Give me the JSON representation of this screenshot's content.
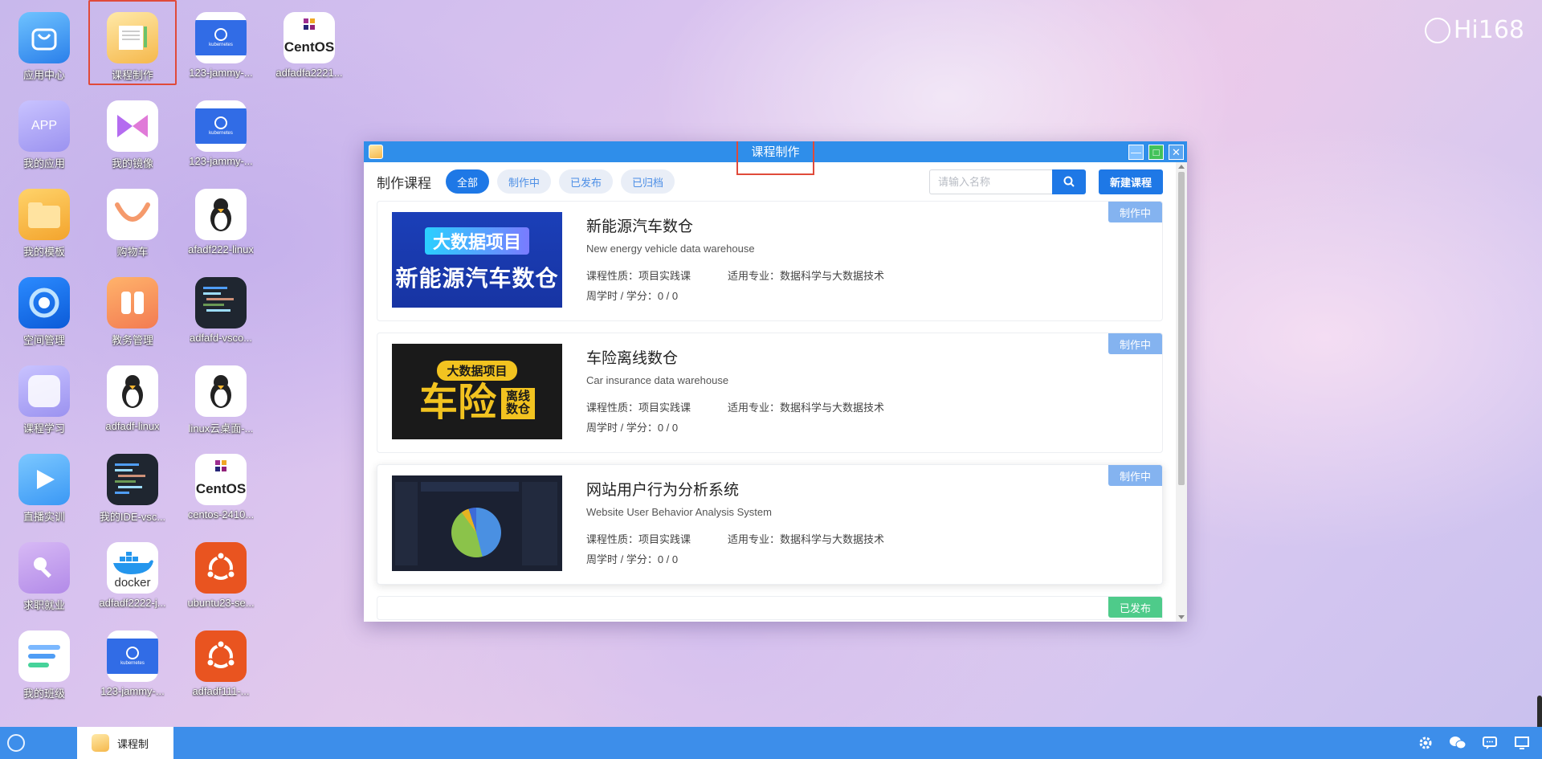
{
  "brand": {
    "text": "Hi168"
  },
  "desktop": {
    "icons": [
      {
        "label": "应用中心"
      },
      {
        "label": "课程制作"
      },
      {
        "label": "123-jammy-..."
      },
      {
        "label": "adfadfa2221..."
      },
      {
        "label": "我的应用",
        "tile_text": "APP"
      },
      {
        "label": "我的镜像"
      },
      {
        "label": "123-jammy-..."
      },
      {
        "label": "我的模板"
      },
      {
        "label": "购物车"
      },
      {
        "label": "afadf222-linux"
      },
      {
        "label": "空间管理"
      },
      {
        "label": "教务管理"
      },
      {
        "label": "adfafd-vsco..."
      },
      {
        "label": "课程学习"
      },
      {
        "label": "adfadf-linux"
      },
      {
        "label": "linux云桌面-..."
      },
      {
        "label": "直播实训"
      },
      {
        "label": "我的IDE-vsc..."
      },
      {
        "label": "centos-2410..."
      },
      {
        "label": "求职就业"
      },
      {
        "label": "adfadf2222-j..."
      },
      {
        "label": "ubuntu23-se..."
      },
      {
        "label": "我的班级"
      },
      {
        "label": "123-jammy-..."
      },
      {
        "label": "adfadf111-..."
      }
    ],
    "tile_texts": {
      "kubernetes": "kubernetes",
      "centos": "CentOS",
      "docker": "docker"
    }
  },
  "window": {
    "title": "课程制作",
    "controls": {
      "minimize": "—",
      "maximize": "□",
      "close": "✕"
    },
    "toolbar": {
      "heading": "制作课程",
      "filters": [
        {
          "label": "全部",
          "active": true
        },
        {
          "label": "制作中",
          "active": false
        },
        {
          "label": "已发布",
          "active": false
        },
        {
          "label": "已归档",
          "active": false
        }
      ],
      "search_placeholder": "请输入名称",
      "new_button": "新建课程"
    },
    "courses": [
      {
        "name": "新能源汽车数仓",
        "english": "New energy vehicle data warehouse",
        "type": "课程性质：项目实践课",
        "major": "适用专业：数据科学与大数据技术",
        "hours": "周学时 / 学分：0 / 0",
        "status": "制作中",
        "thumb_line1": "大数据项目",
        "thumb_line2": "新能源汽车数仓"
      },
      {
        "name": "车险离线数仓",
        "english": "Car insurance data warehouse",
        "type": "课程性质：项目实践课",
        "major": "适用专业：数据科学与大数据技术",
        "hours": "周学时 / 学分：0 / 0",
        "status": "制作中",
        "thumb_line1": "大数据项目",
        "thumb_big": "车险",
        "thumb_small": "离线数仓"
      },
      {
        "name": "网站用户行为分析系统",
        "english": "Website User Behavior Analysis System",
        "type": "课程性质：项目实践课",
        "major": "适用专业：数据科学与大数据技术",
        "hours": "周学时 / 学分：0 / 0",
        "status": "制作中"
      }
    ],
    "peek_status": "已发布"
  },
  "taskbar": {
    "task_label": "课程制",
    "tray_icons": [
      "gear-icon",
      "wechat-icon",
      "chat-icon",
      "monitor-icon"
    ]
  }
}
